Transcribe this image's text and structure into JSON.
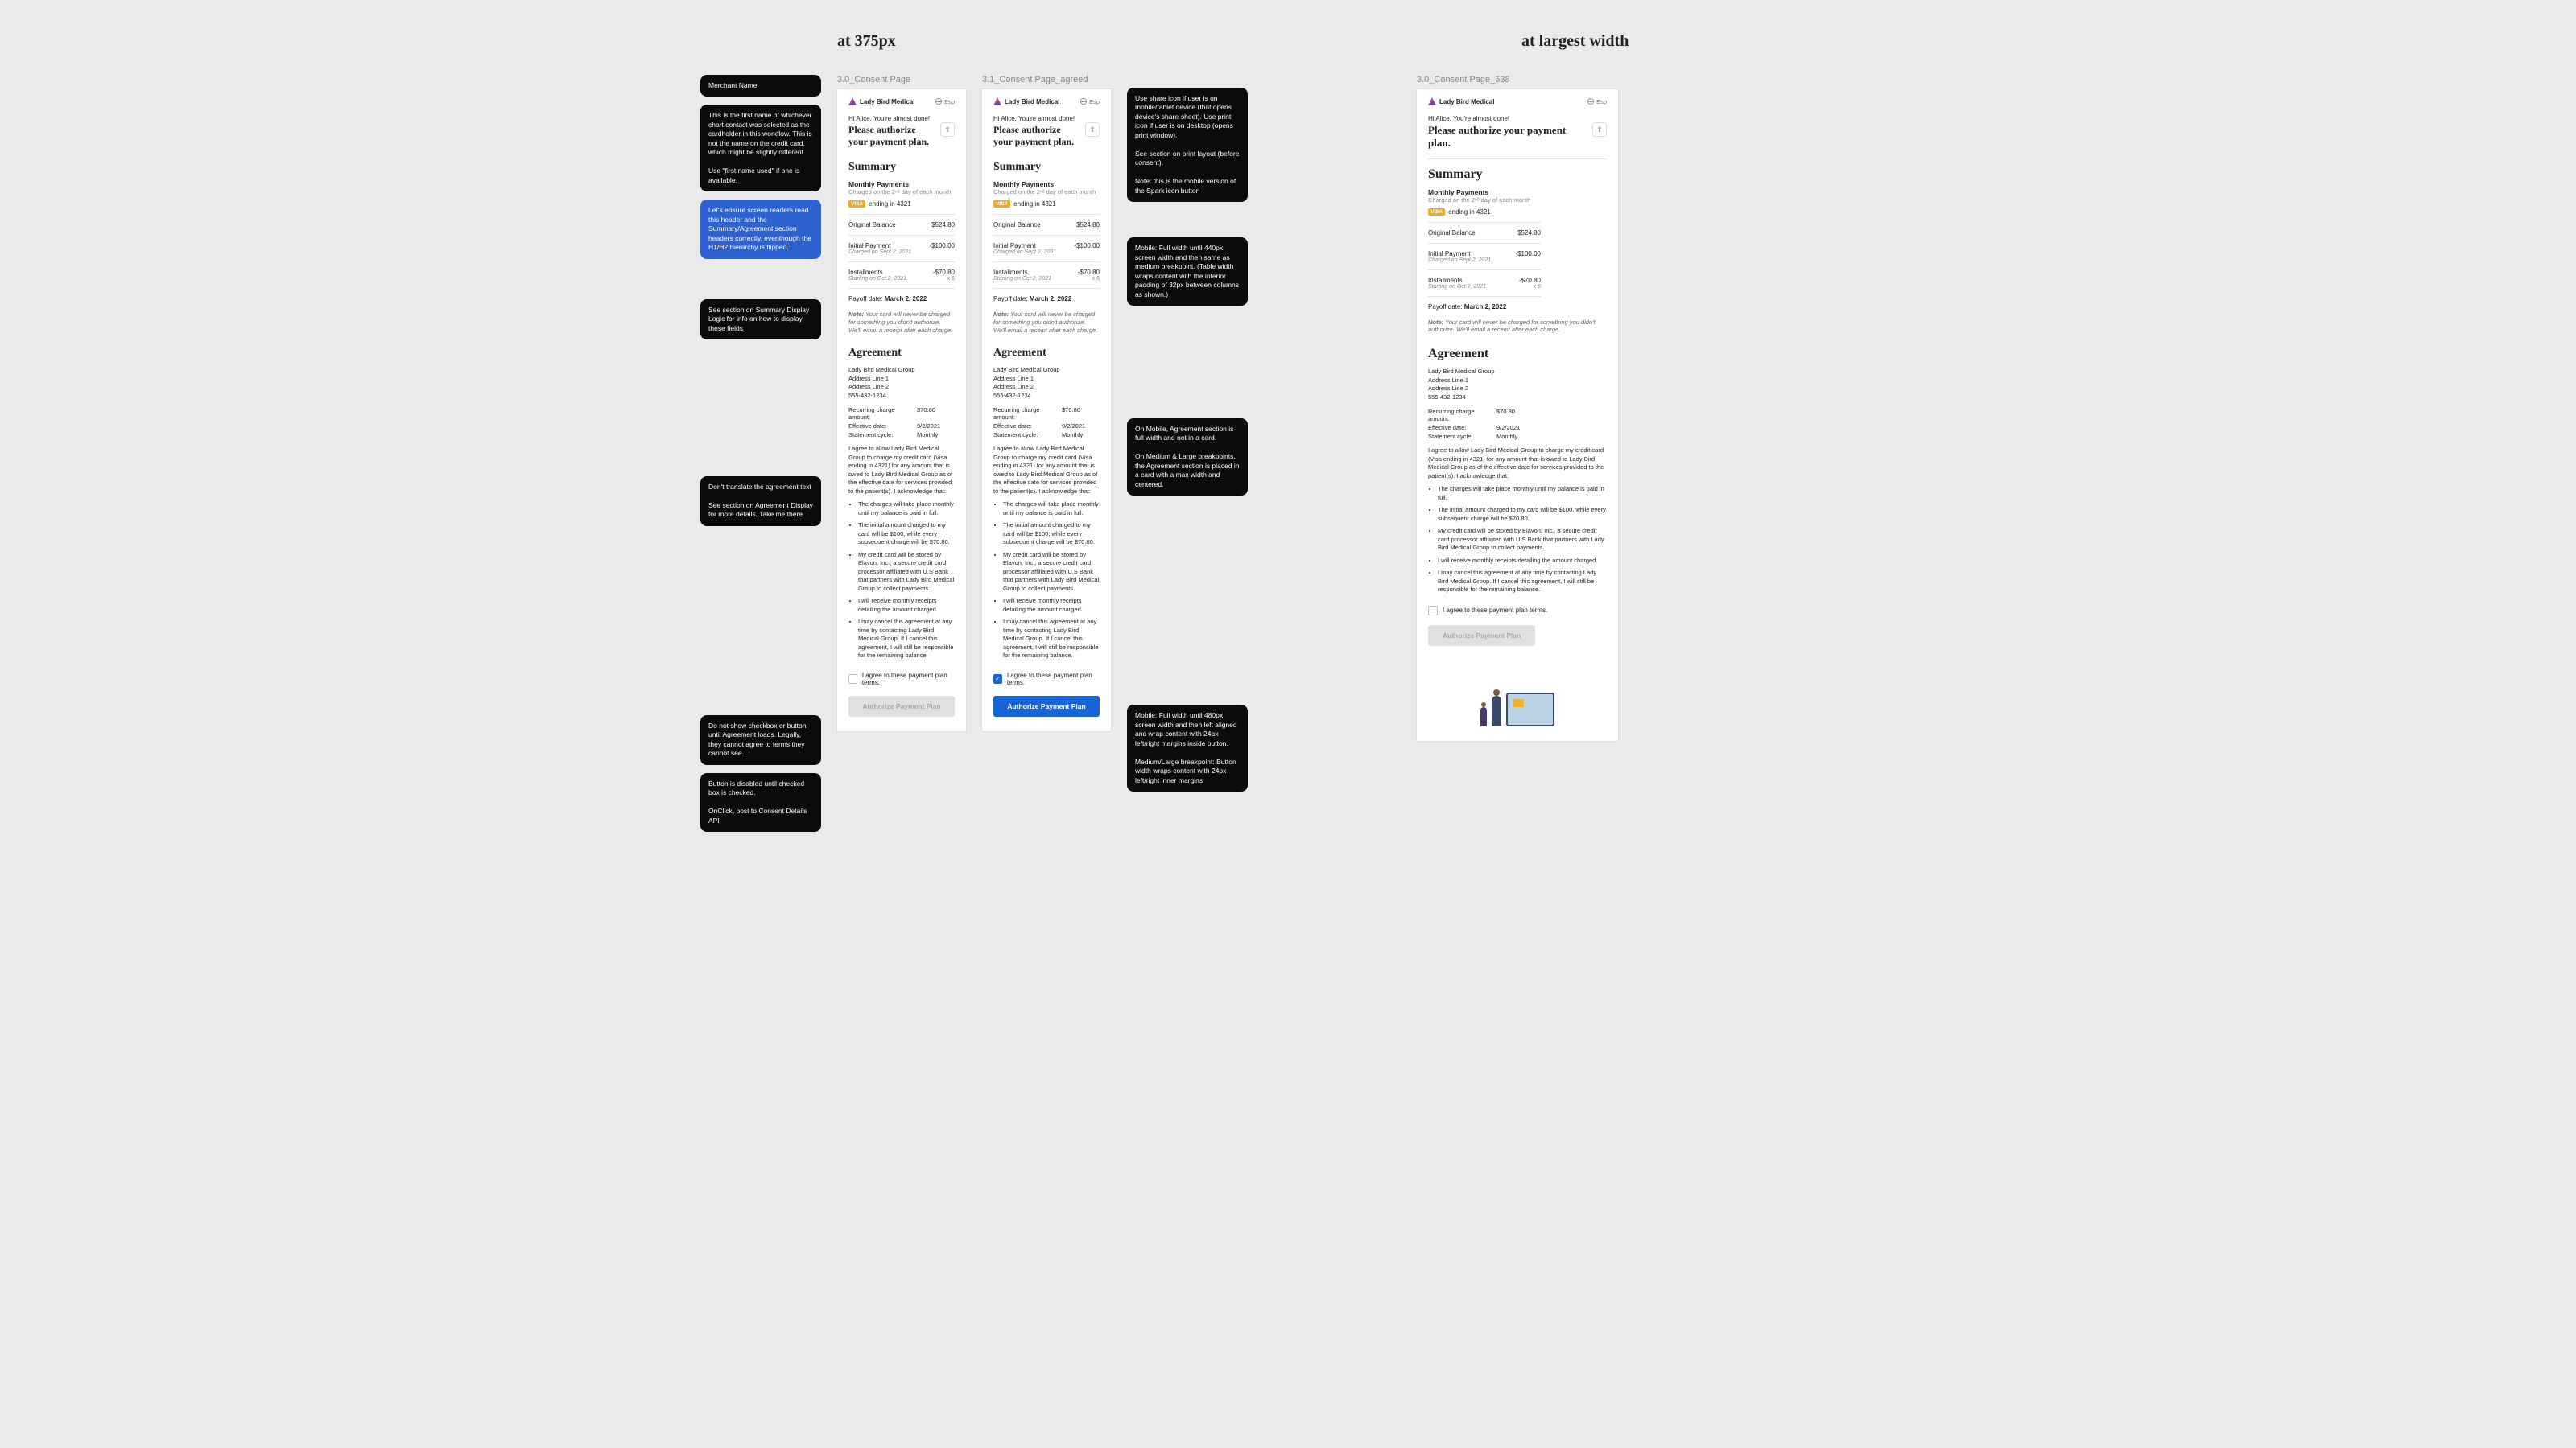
{
  "labels": {
    "col375": "at 375px",
    "colLargest": "at largest width",
    "frame30": "3.0_Consent Page",
    "frame31": "3.1_Consent Page_agreed",
    "frame638": "3.0_Consent Page_638"
  },
  "annotations": {
    "left": {
      "merchant": "Merchant Name",
      "firstName": "This is the first name of whichever chart contact was selected as the cardholder in this workflow. This is not the name on the credit card, which might be slightly different.\n\nUse \"first name used\" if one is available.",
      "a11y": "Let's ensure screen readers read this header and the Summary/Agreement section headers correctly, eventhough the H1/H2 hierarchy is flipped.",
      "summaryLogic": "See section on Summary Display Logic for info on how to display these fields",
      "agreementNote": "Don't translate the agreement text\n\nSee section on Agreement Display for more details.  Take me there",
      "checkboxNote": "Do not show checkbox or button until Agreement loads. Legally, they cannot agree to terms they cannot see.",
      "buttonNote": "Button is disabled until checked box is checked.\n\nOnClick, post to Consent Details API"
    },
    "mid": {
      "share": "Use share icon if user is on mobile/tablet device (that opens device's share-sheet). Use print icon if user is on desktop (opens print window).\n\nSee section on print layout (before consent).\n\nNote: this is the mobile version of the Spark icon button",
      "tableWidth": "Mobile:  Full width until 440px screen width and then same as medium breakpoint.  (Table width wraps content with the interior padding of 32px between columns as shown.)",
      "agreementWidth": "On Mobile, Agreement section is full width and not in a card.\n\nOn Medium & Large breakpoints, the Agreement section is placed in a card with a max width and centered.",
      "buttonWidth": "Mobile:  Full width until 480px screen width and then left aligned and wrap content with 24px left/right margins inside button.\n\nMedium/Large breakpoint:  Button width wraps content with 24px left/right inner margins"
    }
  },
  "merchant": {
    "name": "Lady Bird Medical",
    "lang": "Esp"
  },
  "header": {
    "greeting": "Hi Alice, You're almost done!",
    "headline": "Please authorize your payment plan."
  },
  "summary": {
    "title": "Summary",
    "monthlyLabel": "Monthly Payments",
    "monthlySub": "Charged on the 2ⁿᵈ day of each month",
    "cardBrand": "VISA",
    "cardText": "ending in 4321",
    "rows": {
      "originalBalance": {
        "label": "Original Balance",
        "value": "$524.80"
      },
      "initialPayment": {
        "label": "Initial Payment",
        "sub": "Charged on Sept 2, 2021",
        "value": "-$100.00"
      },
      "installments": {
        "label": "Installments",
        "sub": "Starting on Oct 2, 2021",
        "value": "-$70.80",
        "count": "x 6"
      }
    },
    "payoffLabel": "Payoff date:",
    "payoffDate": "March 2, 2022",
    "noteBold": "Note:",
    "noteText": "Your card will never be charged for something you didn't authorize. We'll email a receipt after each charge."
  },
  "agreement": {
    "title": "Agreement",
    "address": {
      "name": "Lady Bird Medical Group",
      "line1": "Address Line 1",
      "line2": "Address Line 2",
      "phone": "555-432-1234"
    },
    "kv": {
      "recurring": {
        "k": "Recurring charge amount:",
        "v": "$70.80"
      },
      "effective": {
        "k": "Effective date:",
        "v": "9/2/2021"
      },
      "cycle": {
        "k": "Statement cycle:",
        "v": "Monthly"
      }
    },
    "intro": "I agree to allow Lady Bird Medical Group to charge my credit card (Visa ending in 4321) for any amount that is owed to Lady Bird Medical Group as of the effective date for services provided to the patient(s). I acknowledge that:",
    "bullets": [
      "The charges will take place monthly until my balance is paid in full.",
      "The initial amount charged to my card will be $100, while every subsequent charge will be $70.80.",
      "My credit card will be stored by Elavon, Inc., a secure credit card processor affiliated with U.S Bank that partners with Lady Bird Medical Group to collect payments.",
      "I will receive monthly receipts detailing the amount charged.",
      "I may cancel this agreement at any time by contacting Lady Bird Medical Group. If I cancel this agreement, I will still be responsible for the remaining balance."
    ],
    "checkboxLabel": "I agree to these payment plan terms.",
    "cta": "Authorize Payment Plan"
  }
}
